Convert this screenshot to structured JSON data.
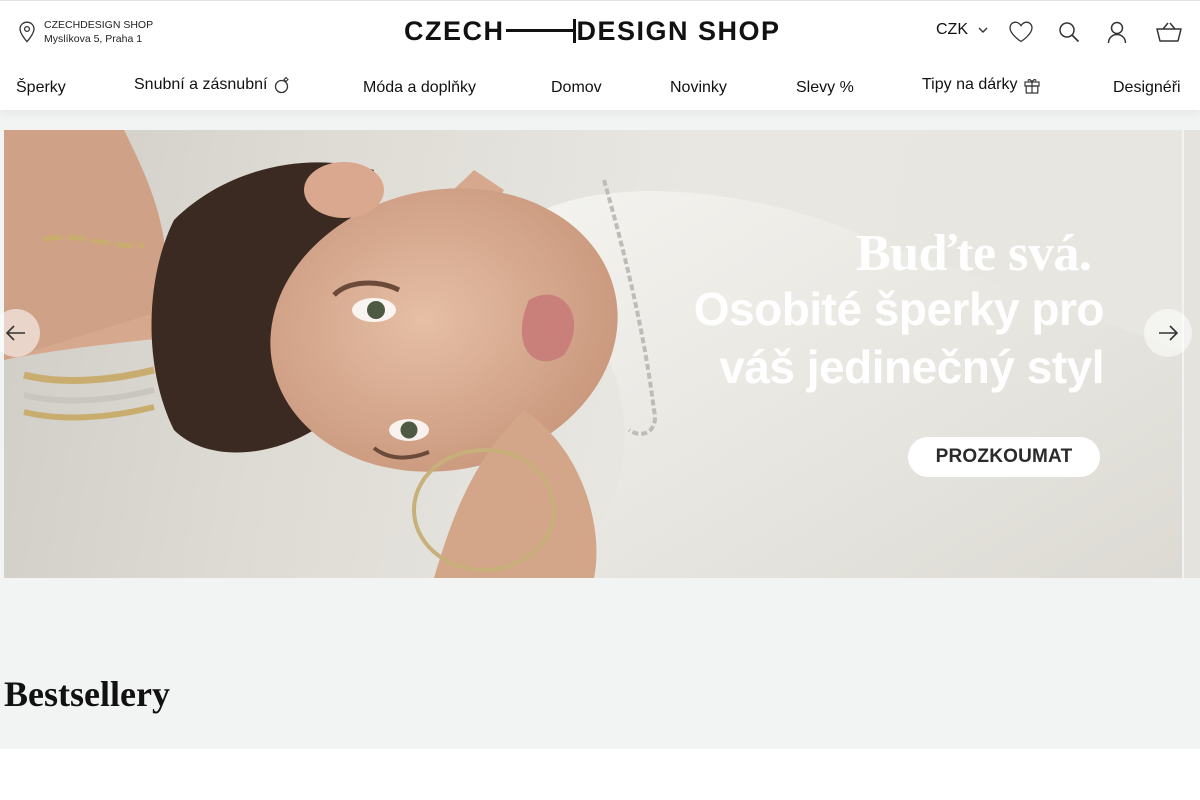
{
  "store": {
    "name": "CZECHDESIGN SHOP",
    "address": "Myslíkova 5, Praha 1"
  },
  "logo": {
    "left": "CZECH",
    "right": "DESIGN SHOP"
  },
  "header": {
    "currency": "CZK",
    "icons": [
      "heart-icon",
      "search-icon",
      "user-icon",
      "basket-icon"
    ]
  },
  "nav": {
    "items": [
      {
        "label": "Šperky"
      },
      {
        "label": "Snubní a zásnubní",
        "icon": "ring-icon"
      },
      {
        "label": "Móda a doplňky"
      },
      {
        "label": "Domov"
      },
      {
        "label": "Novinky"
      },
      {
        "label": "Slevy %"
      },
      {
        "label": "Tipy na dárky",
        "icon": "gift-icon"
      },
      {
        "label": "Designéři"
      }
    ]
  },
  "hero": {
    "headline_1": "Buďte svá.",
    "headline_2_line_1": "Osobité šperky pro",
    "headline_2_line_2": "váš jedinečný styl",
    "cta": "PROZKOUMAT"
  },
  "section": {
    "title": "Bestsellery"
  },
  "colors": {
    "background": "#f2f4f3",
    "header_bg": "#ffffff",
    "text": "#111111",
    "hero_text": "#ffffff"
  }
}
